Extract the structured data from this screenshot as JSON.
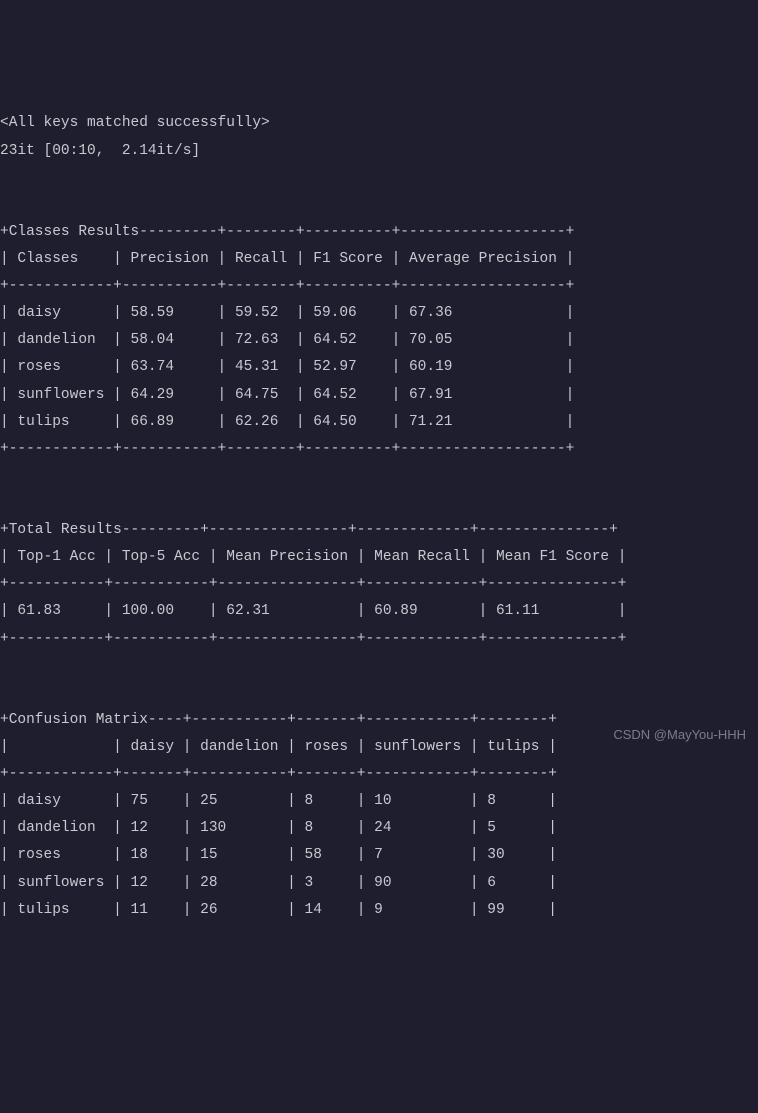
{
  "header": {
    "keys_matched": "<All keys matched successfully>",
    "progress": "23it [00:10,  2.14it/s]"
  },
  "classes_table": {
    "title": "Classes Results",
    "sep_top": "+Classes Results---------+--------+----------+-------------------+",
    "header_row": "| Classes    | Precision | Recall | F1 Score | Average Precision |",
    "sep": "+------------+-----------+--------+----------+-------------------+",
    "rows": [
      "| daisy      | 58.59     | 59.52  | 59.06    | 67.36             |",
      "| dandelion  | 58.04     | 72.63  | 64.52    | 70.05             |",
      "| roses      | 63.74     | 45.31  | 52.97    | 60.19             |",
      "| sunflowers | 64.29     | 64.75  | 64.52    | 67.91             |",
      "| tulips     | 66.89     | 62.26  | 64.50    | 71.21             |"
    ]
  },
  "total_table": {
    "title": "Total Results",
    "sep_top": "+Total Results---------+----------------+-------------+---------------+",
    "header_row": "| Top-1 Acc | Top-5 Acc | Mean Precision | Mean Recall | Mean F1 Score |",
    "sep": "+-----------+-----------+----------------+-------------+---------------+",
    "rows": [
      "| 61.83     | 100.00    | 62.31          | 60.89       | 61.11         |"
    ]
  },
  "confusion_table": {
    "title": "Confusion Matrix",
    "sep_top": "+Confusion Matrix----+-----------+-------+------------+--------+",
    "header_row": "|            | daisy | dandelion | roses | sunflowers | tulips |",
    "sep": "+------------+-------+-----------+-------+------------+--------+",
    "rows": [
      "| daisy      | 75    | 25        | 8     | 10         | 8      |",
      "| dandelion  | 12    | 130       | 8     | 24         | 5      |",
      "| roses      | 18    | 15        | 58    | 7          | 30     |",
      "| sunflowers | 12    | 28        | 3     | 90         | 6      |",
      "| tulips     | 11    | 26        | 14    | 9          | 99     |"
    ]
  },
  "watermark": "CSDN @MayYou-HHH",
  "chart_data": [
    {
      "type": "table",
      "title": "Classes Results",
      "columns": [
        "Classes",
        "Precision",
        "Recall",
        "F1 Score",
        "Average Precision"
      ],
      "rows": [
        [
          "daisy",
          58.59,
          59.52,
          59.06,
          67.36
        ],
        [
          "dandelion",
          58.04,
          72.63,
          64.52,
          70.05
        ],
        [
          "roses",
          63.74,
          45.31,
          52.97,
          60.19
        ],
        [
          "sunflowers",
          64.29,
          64.75,
          64.52,
          67.91
        ],
        [
          "tulips",
          66.89,
          62.26,
          64.5,
          71.21
        ]
      ]
    },
    {
      "type": "table",
      "title": "Total Results",
      "columns": [
        "Top-1 Acc",
        "Top-5 Acc",
        "Mean Precision",
        "Mean Recall",
        "Mean F1 Score"
      ],
      "rows": [
        [
          61.83,
          100.0,
          62.31,
          60.89,
          61.11
        ]
      ]
    },
    {
      "type": "table",
      "title": "Confusion Matrix",
      "columns": [
        "",
        "daisy",
        "dandelion",
        "roses",
        "sunflowers",
        "tulips"
      ],
      "rows": [
        [
          "daisy",
          75,
          25,
          8,
          10,
          8
        ],
        [
          "dandelion",
          12,
          130,
          8,
          24,
          5
        ],
        [
          "roses",
          18,
          15,
          58,
          7,
          30
        ],
        [
          "sunflowers",
          12,
          28,
          3,
          90,
          6
        ],
        [
          "tulips",
          11,
          26,
          14,
          9,
          99
        ]
      ]
    }
  ]
}
